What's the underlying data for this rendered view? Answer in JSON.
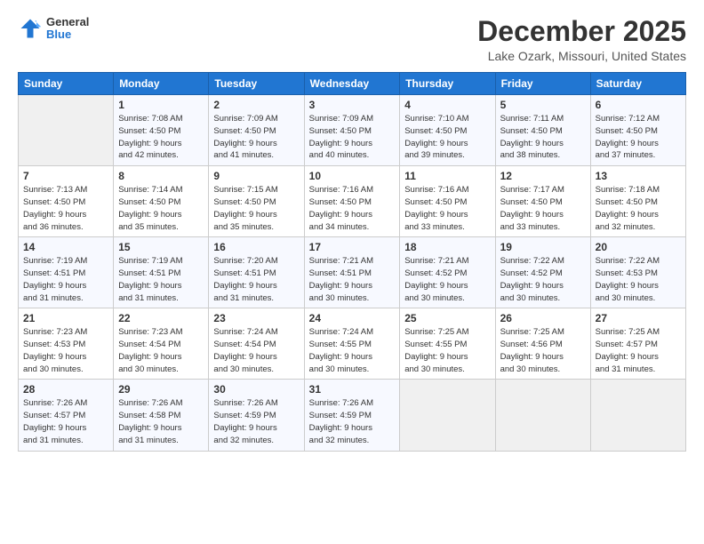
{
  "logo": {
    "general": "General",
    "blue": "Blue"
  },
  "title": "December 2025",
  "location": "Lake Ozark, Missouri, United States",
  "days_of_week": [
    "Sunday",
    "Monday",
    "Tuesday",
    "Wednesday",
    "Thursday",
    "Friday",
    "Saturday"
  ],
  "weeks": [
    [
      {
        "num": "",
        "info": ""
      },
      {
        "num": "1",
        "info": "Sunrise: 7:08 AM\nSunset: 4:50 PM\nDaylight: 9 hours\nand 42 minutes."
      },
      {
        "num": "2",
        "info": "Sunrise: 7:09 AM\nSunset: 4:50 PM\nDaylight: 9 hours\nand 41 minutes."
      },
      {
        "num": "3",
        "info": "Sunrise: 7:09 AM\nSunset: 4:50 PM\nDaylight: 9 hours\nand 40 minutes."
      },
      {
        "num": "4",
        "info": "Sunrise: 7:10 AM\nSunset: 4:50 PM\nDaylight: 9 hours\nand 39 minutes."
      },
      {
        "num": "5",
        "info": "Sunrise: 7:11 AM\nSunset: 4:50 PM\nDaylight: 9 hours\nand 38 minutes."
      },
      {
        "num": "6",
        "info": "Sunrise: 7:12 AM\nSunset: 4:50 PM\nDaylight: 9 hours\nand 37 minutes."
      }
    ],
    [
      {
        "num": "7",
        "info": "Sunrise: 7:13 AM\nSunset: 4:50 PM\nDaylight: 9 hours\nand 36 minutes."
      },
      {
        "num": "8",
        "info": "Sunrise: 7:14 AM\nSunset: 4:50 PM\nDaylight: 9 hours\nand 35 minutes."
      },
      {
        "num": "9",
        "info": "Sunrise: 7:15 AM\nSunset: 4:50 PM\nDaylight: 9 hours\nand 35 minutes."
      },
      {
        "num": "10",
        "info": "Sunrise: 7:16 AM\nSunset: 4:50 PM\nDaylight: 9 hours\nand 34 minutes."
      },
      {
        "num": "11",
        "info": "Sunrise: 7:16 AM\nSunset: 4:50 PM\nDaylight: 9 hours\nand 33 minutes."
      },
      {
        "num": "12",
        "info": "Sunrise: 7:17 AM\nSunset: 4:50 PM\nDaylight: 9 hours\nand 33 minutes."
      },
      {
        "num": "13",
        "info": "Sunrise: 7:18 AM\nSunset: 4:50 PM\nDaylight: 9 hours\nand 32 minutes."
      }
    ],
    [
      {
        "num": "14",
        "info": "Sunrise: 7:19 AM\nSunset: 4:51 PM\nDaylight: 9 hours\nand 31 minutes."
      },
      {
        "num": "15",
        "info": "Sunrise: 7:19 AM\nSunset: 4:51 PM\nDaylight: 9 hours\nand 31 minutes."
      },
      {
        "num": "16",
        "info": "Sunrise: 7:20 AM\nSunset: 4:51 PM\nDaylight: 9 hours\nand 31 minutes."
      },
      {
        "num": "17",
        "info": "Sunrise: 7:21 AM\nSunset: 4:51 PM\nDaylight: 9 hours\nand 30 minutes."
      },
      {
        "num": "18",
        "info": "Sunrise: 7:21 AM\nSunset: 4:52 PM\nDaylight: 9 hours\nand 30 minutes."
      },
      {
        "num": "19",
        "info": "Sunrise: 7:22 AM\nSunset: 4:52 PM\nDaylight: 9 hours\nand 30 minutes."
      },
      {
        "num": "20",
        "info": "Sunrise: 7:22 AM\nSunset: 4:53 PM\nDaylight: 9 hours\nand 30 minutes."
      }
    ],
    [
      {
        "num": "21",
        "info": "Sunrise: 7:23 AM\nSunset: 4:53 PM\nDaylight: 9 hours\nand 30 minutes."
      },
      {
        "num": "22",
        "info": "Sunrise: 7:23 AM\nSunset: 4:54 PM\nDaylight: 9 hours\nand 30 minutes."
      },
      {
        "num": "23",
        "info": "Sunrise: 7:24 AM\nSunset: 4:54 PM\nDaylight: 9 hours\nand 30 minutes."
      },
      {
        "num": "24",
        "info": "Sunrise: 7:24 AM\nSunset: 4:55 PM\nDaylight: 9 hours\nand 30 minutes."
      },
      {
        "num": "25",
        "info": "Sunrise: 7:25 AM\nSunset: 4:55 PM\nDaylight: 9 hours\nand 30 minutes."
      },
      {
        "num": "26",
        "info": "Sunrise: 7:25 AM\nSunset: 4:56 PM\nDaylight: 9 hours\nand 30 minutes."
      },
      {
        "num": "27",
        "info": "Sunrise: 7:25 AM\nSunset: 4:57 PM\nDaylight: 9 hours\nand 31 minutes."
      }
    ],
    [
      {
        "num": "28",
        "info": "Sunrise: 7:26 AM\nSunset: 4:57 PM\nDaylight: 9 hours\nand 31 minutes."
      },
      {
        "num": "29",
        "info": "Sunrise: 7:26 AM\nSunset: 4:58 PM\nDaylight: 9 hours\nand 31 minutes."
      },
      {
        "num": "30",
        "info": "Sunrise: 7:26 AM\nSunset: 4:59 PM\nDaylight: 9 hours\nand 32 minutes."
      },
      {
        "num": "31",
        "info": "Sunrise: 7:26 AM\nSunset: 4:59 PM\nDaylight: 9 hours\nand 32 minutes."
      },
      {
        "num": "",
        "info": ""
      },
      {
        "num": "",
        "info": ""
      },
      {
        "num": "",
        "info": ""
      }
    ]
  ]
}
